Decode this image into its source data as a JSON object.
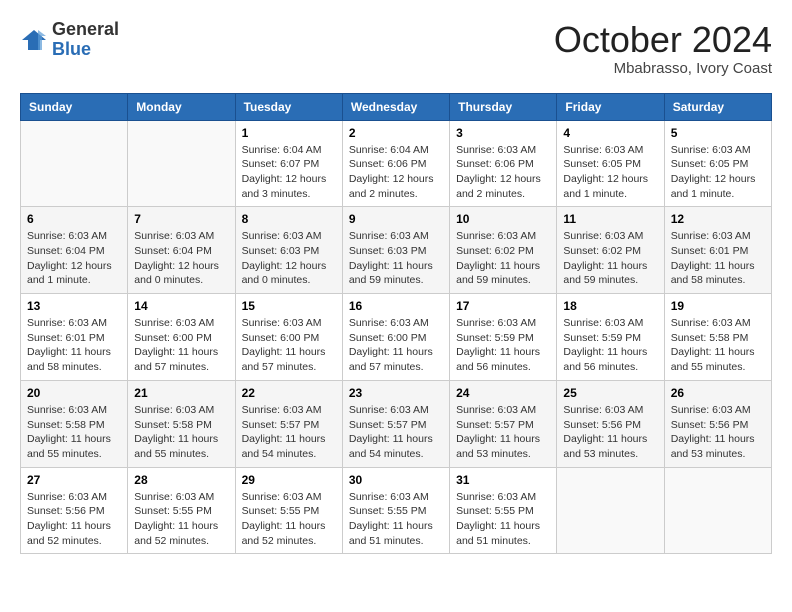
{
  "header": {
    "logo_general": "General",
    "logo_blue": "Blue",
    "month_title": "October 2024",
    "subtitle": "Mbabrasso, Ivory Coast"
  },
  "days_of_week": [
    "Sunday",
    "Monday",
    "Tuesday",
    "Wednesday",
    "Thursday",
    "Friday",
    "Saturday"
  ],
  "weeks": [
    [
      {
        "day": "",
        "info": ""
      },
      {
        "day": "",
        "info": ""
      },
      {
        "day": "1",
        "info": "Sunrise: 6:04 AM\nSunset: 6:07 PM\nDaylight: 12 hours and 3 minutes."
      },
      {
        "day": "2",
        "info": "Sunrise: 6:04 AM\nSunset: 6:06 PM\nDaylight: 12 hours and 2 minutes."
      },
      {
        "day": "3",
        "info": "Sunrise: 6:03 AM\nSunset: 6:06 PM\nDaylight: 12 hours and 2 minutes."
      },
      {
        "day": "4",
        "info": "Sunrise: 6:03 AM\nSunset: 6:05 PM\nDaylight: 12 hours and 1 minute."
      },
      {
        "day": "5",
        "info": "Sunrise: 6:03 AM\nSunset: 6:05 PM\nDaylight: 12 hours and 1 minute."
      }
    ],
    [
      {
        "day": "6",
        "info": "Sunrise: 6:03 AM\nSunset: 6:04 PM\nDaylight: 12 hours and 1 minute."
      },
      {
        "day": "7",
        "info": "Sunrise: 6:03 AM\nSunset: 6:04 PM\nDaylight: 12 hours and 0 minutes."
      },
      {
        "day": "8",
        "info": "Sunrise: 6:03 AM\nSunset: 6:03 PM\nDaylight: 12 hours and 0 minutes."
      },
      {
        "day": "9",
        "info": "Sunrise: 6:03 AM\nSunset: 6:03 PM\nDaylight: 11 hours and 59 minutes."
      },
      {
        "day": "10",
        "info": "Sunrise: 6:03 AM\nSunset: 6:02 PM\nDaylight: 11 hours and 59 minutes."
      },
      {
        "day": "11",
        "info": "Sunrise: 6:03 AM\nSunset: 6:02 PM\nDaylight: 11 hours and 59 minutes."
      },
      {
        "day": "12",
        "info": "Sunrise: 6:03 AM\nSunset: 6:01 PM\nDaylight: 11 hours and 58 minutes."
      }
    ],
    [
      {
        "day": "13",
        "info": "Sunrise: 6:03 AM\nSunset: 6:01 PM\nDaylight: 11 hours and 58 minutes."
      },
      {
        "day": "14",
        "info": "Sunrise: 6:03 AM\nSunset: 6:00 PM\nDaylight: 11 hours and 57 minutes."
      },
      {
        "day": "15",
        "info": "Sunrise: 6:03 AM\nSunset: 6:00 PM\nDaylight: 11 hours and 57 minutes."
      },
      {
        "day": "16",
        "info": "Sunrise: 6:03 AM\nSunset: 6:00 PM\nDaylight: 11 hours and 57 minutes."
      },
      {
        "day": "17",
        "info": "Sunrise: 6:03 AM\nSunset: 5:59 PM\nDaylight: 11 hours and 56 minutes."
      },
      {
        "day": "18",
        "info": "Sunrise: 6:03 AM\nSunset: 5:59 PM\nDaylight: 11 hours and 56 minutes."
      },
      {
        "day": "19",
        "info": "Sunrise: 6:03 AM\nSunset: 5:58 PM\nDaylight: 11 hours and 55 minutes."
      }
    ],
    [
      {
        "day": "20",
        "info": "Sunrise: 6:03 AM\nSunset: 5:58 PM\nDaylight: 11 hours and 55 minutes."
      },
      {
        "day": "21",
        "info": "Sunrise: 6:03 AM\nSunset: 5:58 PM\nDaylight: 11 hours and 55 minutes."
      },
      {
        "day": "22",
        "info": "Sunrise: 6:03 AM\nSunset: 5:57 PM\nDaylight: 11 hours and 54 minutes."
      },
      {
        "day": "23",
        "info": "Sunrise: 6:03 AM\nSunset: 5:57 PM\nDaylight: 11 hours and 54 minutes."
      },
      {
        "day": "24",
        "info": "Sunrise: 6:03 AM\nSunset: 5:57 PM\nDaylight: 11 hours and 53 minutes."
      },
      {
        "day": "25",
        "info": "Sunrise: 6:03 AM\nSunset: 5:56 PM\nDaylight: 11 hours and 53 minutes."
      },
      {
        "day": "26",
        "info": "Sunrise: 6:03 AM\nSunset: 5:56 PM\nDaylight: 11 hours and 53 minutes."
      }
    ],
    [
      {
        "day": "27",
        "info": "Sunrise: 6:03 AM\nSunset: 5:56 PM\nDaylight: 11 hours and 52 minutes."
      },
      {
        "day": "28",
        "info": "Sunrise: 6:03 AM\nSunset: 5:55 PM\nDaylight: 11 hours and 52 minutes."
      },
      {
        "day": "29",
        "info": "Sunrise: 6:03 AM\nSunset: 5:55 PM\nDaylight: 11 hours and 52 minutes."
      },
      {
        "day": "30",
        "info": "Sunrise: 6:03 AM\nSunset: 5:55 PM\nDaylight: 11 hours and 51 minutes."
      },
      {
        "day": "31",
        "info": "Sunrise: 6:03 AM\nSunset: 5:55 PM\nDaylight: 11 hours and 51 minutes."
      },
      {
        "day": "",
        "info": ""
      },
      {
        "day": "",
        "info": ""
      }
    ]
  ]
}
